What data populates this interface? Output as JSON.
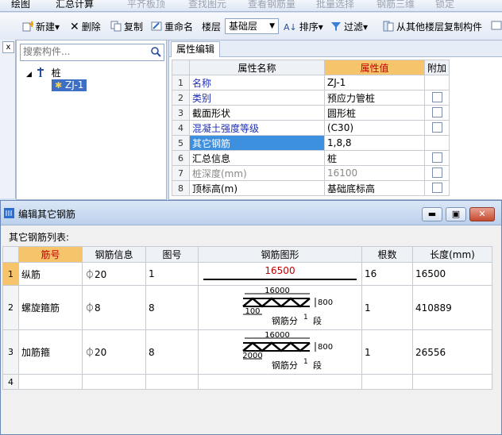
{
  "toolbar_top": {
    "items": [
      "绘图",
      "汇总计算",
      "平齐板顶",
      "查找图元",
      "查看钢筋量",
      "批量选择",
      "钢筋三维",
      "锁定"
    ]
  },
  "toolbar": {
    "new_label": "新建",
    "delete_label": "删除",
    "copy_label": "复制",
    "rename_label": "重命名",
    "floor_label": "楼层",
    "floor_value": "基础层",
    "sort_label": "排序",
    "filter_label": "过滤",
    "copy_from_floor_label": "从其他楼层复制构件"
  },
  "left_strip": {
    "close_label": "x"
  },
  "tree": {
    "search_placeholder": "搜索构件...",
    "root_label": "桩",
    "child_label": "ZJ-1"
  },
  "properties": {
    "tab_label": "属性编辑",
    "headers": {
      "name": "属性名称",
      "value": "属性值",
      "extra": "附加"
    },
    "rows": [
      {
        "num": "1",
        "name": "名称",
        "value": "ZJ-1",
        "check": false,
        "style": "blue"
      },
      {
        "num": "2",
        "name": "类别",
        "value": "预应力管桩",
        "check": true,
        "style": "blue"
      },
      {
        "num": "3",
        "name": "截面形状",
        "value": "圆形桩",
        "check": true,
        "style": ""
      },
      {
        "num": "4",
        "name": "混凝土强度等级",
        "value": "(C30)",
        "check": true,
        "style": "blue"
      },
      {
        "num": "5",
        "name": "其它钢筋",
        "value": "1,8,8",
        "check": false,
        "style": "selected"
      },
      {
        "num": "6",
        "name": "汇总信息",
        "value": "桩",
        "check": true,
        "style": ""
      },
      {
        "num": "7",
        "name": "桩深度(mm)",
        "value": "16100",
        "check": true,
        "style": "gray"
      },
      {
        "num": "8",
        "name": "顶标高(m)",
        "value": "基础底标高",
        "check": true,
        "style": ""
      }
    ]
  },
  "dialog": {
    "title": "编辑其它钢筋",
    "list_label": "其它钢筋列表:",
    "headers": {
      "no": "筋号",
      "info": "钢筋信息",
      "fig": "图号",
      "shape": "钢筋图形",
      "count": "根数",
      "length": "长度(mm)"
    },
    "rows": [
      {
        "num": "1",
        "name": "纵筋",
        "info": "⏀20",
        "fig": "1",
        "count": "16",
        "length": "16500",
        "shape": {
          "kind": "line",
          "value": "16500"
        }
      },
      {
        "num": "2",
        "name": "螺旋箍筋",
        "info": "⏀8",
        "fig": "8",
        "count": "1",
        "length": "410889",
        "shape": {
          "kind": "spiral",
          "top": "16000",
          "side": "800",
          "pitch": "100",
          "seg_label": "钢筋分",
          "seg_num": "1",
          "seg_suffix": "段"
        }
      },
      {
        "num": "3",
        "name": "加筋箍",
        "info": "⏀20",
        "fig": "8",
        "count": "1",
        "length": "26556",
        "shape": {
          "kind": "spiral",
          "top": "16000",
          "side": "800",
          "pitch": "2000",
          "seg_label": "钢筋分",
          "seg_num": "1",
          "seg_suffix": "段"
        }
      },
      {
        "num": "4",
        "name": "",
        "info": "",
        "fig": "",
        "count": "",
        "length": "",
        "shape": {
          "kind": "none"
        }
      }
    ]
  }
}
